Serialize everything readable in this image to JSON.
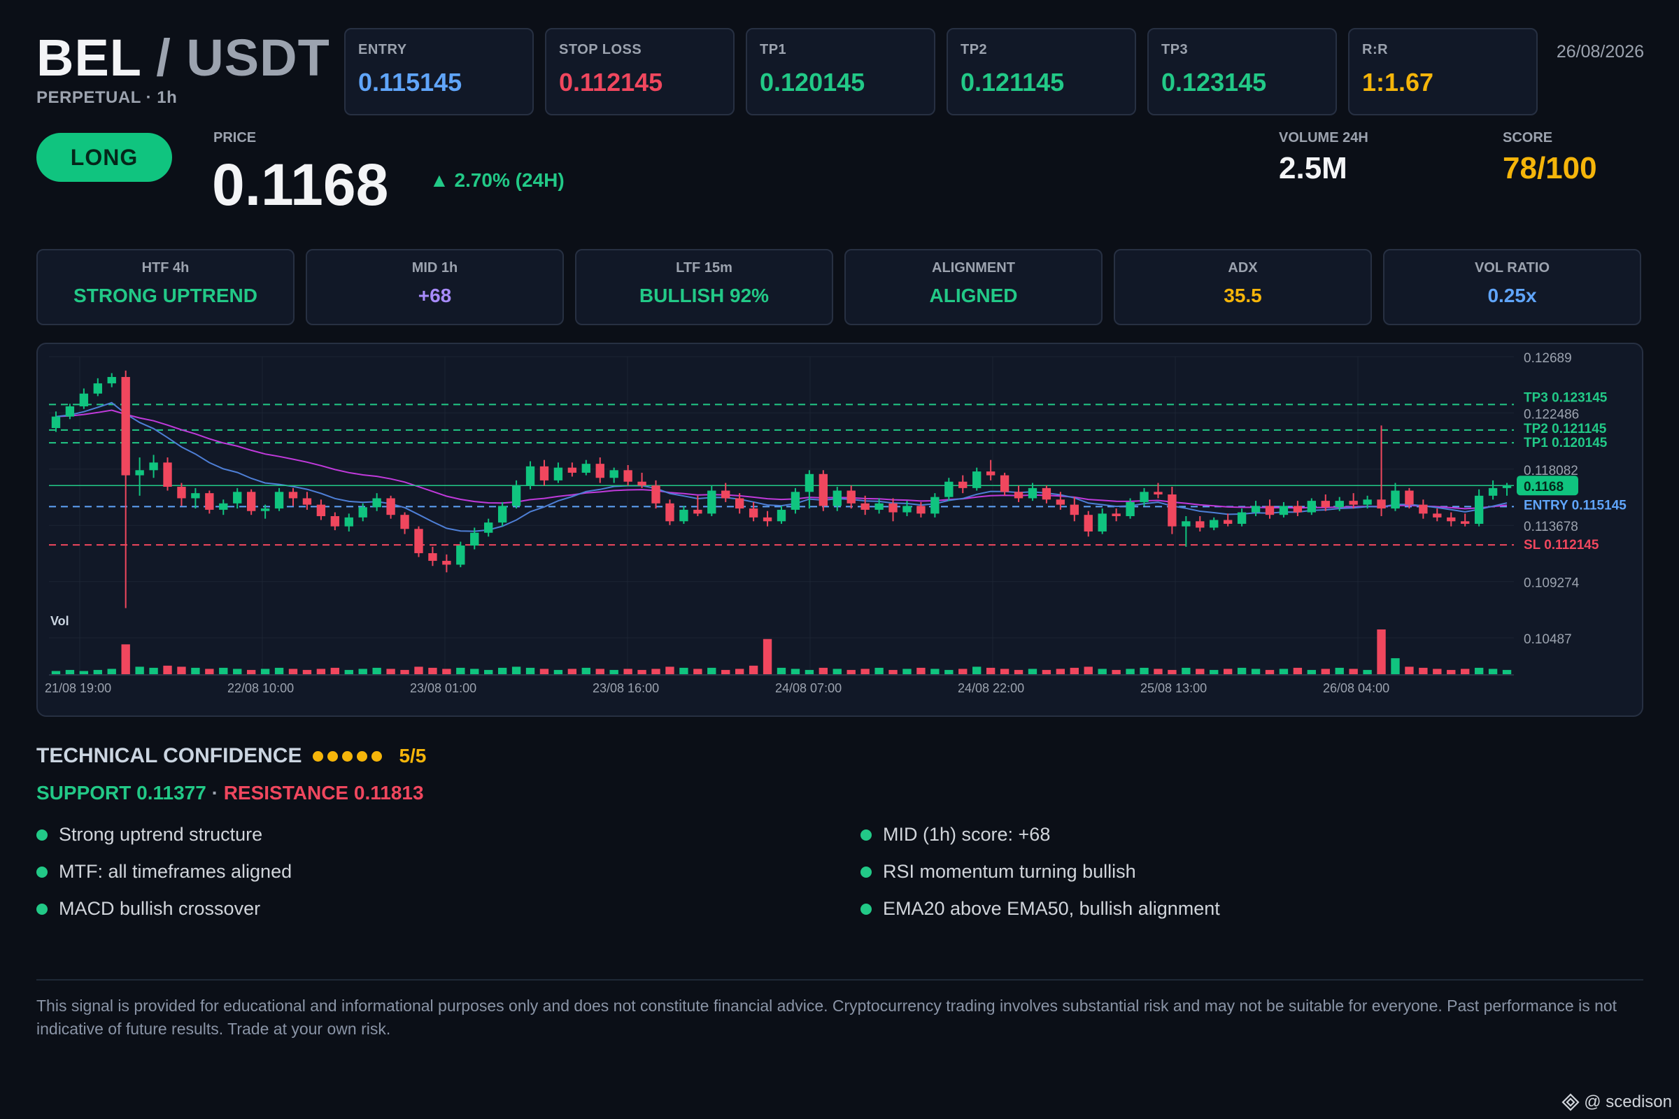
{
  "header": {
    "base": "BEL",
    "separator": " / ",
    "quote": "USDT",
    "subtitle": "PERPETUAL · 1h",
    "date": "26/08/2026"
  },
  "levels": [
    {
      "label": "ENTRY",
      "value": "0.115145",
      "color": "#60a5fa"
    },
    {
      "label": "STOP LOSS",
      "value": "0.112145",
      "color": "#f0475e"
    },
    {
      "label": "TP1",
      "value": "0.120145",
      "color": "#22c987"
    },
    {
      "label": "TP2",
      "value": "0.121145",
      "color": "#22c987"
    },
    {
      "label": "TP3",
      "value": "0.123145",
      "color": "#22c987"
    },
    {
      "label": "R:R",
      "value": "1:1.67",
      "color": "#f5b50a"
    }
  ],
  "signal": {
    "direction": "LONG"
  },
  "price": {
    "label": "PRICE",
    "value": "0.1168",
    "change": "▲ 2.70% (24H)"
  },
  "volume": {
    "label": "VOLUME 24H",
    "value": "2.5M"
  },
  "score": {
    "label": "SCORE",
    "value": "78/100"
  },
  "timeframes": [
    {
      "label": "HTF 4h",
      "value": "STRONG UPTREND",
      "color": "#22c987"
    },
    {
      "label": "MID 1h",
      "value": "+68",
      "color": "#a78bfa"
    },
    {
      "label": "LTF 15m",
      "value": "BULLISH 92%",
      "color": "#22c987"
    },
    {
      "label": "ALIGNMENT",
      "value": "ALIGNED",
      "color": "#22c987"
    },
    {
      "label": "ADX",
      "value": "35.5",
      "color": "#f5b50a"
    },
    {
      "label": "VOL RATIO",
      "value": "0.25x",
      "color": "#60a5fa"
    }
  ],
  "chart_data": {
    "type": "candlestick",
    "ylim": [
      0.10487,
      0.12689
    ],
    "y_ticks": [
      "0.12689",
      "0.122486",
      "0.118082",
      "0.113678",
      "0.109274",
      "0.10487"
    ],
    "x_ticks": [
      "21/08 19:00",
      "22/08 10:00",
      "23/08 01:00",
      "23/08 16:00",
      "24/08 07:00",
      "24/08 22:00",
      "25/08 13:00",
      "26/08 04:00"
    ],
    "volume_label": "Vol",
    "levels": [
      {
        "label": "TP3 0.123145",
        "value": 0.123145,
        "color": "#22c987"
      },
      {
        "label": "TP2 0.121145",
        "value": 0.121145,
        "color": "#22c987"
      },
      {
        "label": "TP1 0.120145",
        "value": 0.120145,
        "color": "#22c987"
      },
      {
        "label": "ENTRY 0.115145",
        "value": 0.115145,
        "color": "#60a5fa"
      },
      {
        "label": "SL 0.112145",
        "value": 0.112145,
        "color": "#f0475e"
      }
    ],
    "current_price": {
      "label": "0.1168",
      "value": 0.1168
    },
    "candles": [
      [
        0.1213,
        0.1226,
        0.121,
        0.1222
      ],
      [
        0.1222,
        0.1232,
        0.122,
        0.123
      ],
      [
        0.123,
        0.1244,
        0.1228,
        0.124
      ],
      [
        0.124,
        0.1252,
        0.1238,
        0.1248
      ],
      [
        0.1248,
        0.1256,
        0.1245,
        0.1253
      ],
      [
        0.1253,
        0.1258,
        0.1072,
        0.1176
      ],
      [
        0.1176,
        0.119,
        0.116,
        0.118
      ],
      [
        0.118,
        0.1192,
        0.1174,
        0.1186
      ],
      [
        0.1186,
        0.119,
        0.1164,
        0.1167
      ],
      [
        0.1167,
        0.117,
        0.1152,
        0.1158
      ],
      [
        0.1158,
        0.1166,
        0.115,
        0.1162
      ],
      [
        0.1162,
        0.1164,
        0.1146,
        0.1149
      ],
      [
        0.1149,
        0.1157,
        0.1145,
        0.1154
      ],
      [
        0.1154,
        0.1166,
        0.115,
        0.1163
      ],
      [
        0.1163,
        0.1165,
        0.1145,
        0.1148
      ],
      [
        0.1148,
        0.1153,
        0.1142,
        0.115
      ],
      [
        0.115,
        0.1166,
        0.1148,
        0.1163
      ],
      [
        0.1163,
        0.1166,
        0.1152,
        0.1158
      ],
      [
        0.1158,
        0.1163,
        0.1149,
        0.1153
      ],
      [
        0.1153,
        0.1157,
        0.1141,
        0.1144
      ],
      [
        0.1144,
        0.1147,
        0.1133,
        0.1136
      ],
      [
        0.1136,
        0.1146,
        0.1132,
        0.1143
      ],
      [
        0.1143,
        0.1154,
        0.114,
        0.1151
      ],
      [
        0.1151,
        0.1162,
        0.1148,
        0.1158
      ],
      [
        0.1158,
        0.116,
        0.1142,
        0.1145
      ],
      [
        0.1145,
        0.1147,
        0.113,
        0.1134
      ],
      [
        0.1134,
        0.1136,
        0.1112,
        0.1115
      ],
      [
        0.1115,
        0.112,
        0.1105,
        0.1109
      ],
      [
        0.1109,
        0.1114,
        0.11,
        0.1106
      ],
      [
        0.1106,
        0.1124,
        0.1104,
        0.1121
      ],
      [
        0.1121,
        0.1135,
        0.1118,
        0.1131
      ],
      [
        0.1131,
        0.1142,
        0.1128,
        0.1139
      ],
      [
        0.1139,
        0.1155,
        0.1136,
        0.1152
      ],
      [
        0.1152,
        0.1172,
        0.115,
        0.1168
      ],
      [
        0.1168,
        0.1187,
        0.1165,
        0.1183
      ],
      [
        0.1183,
        0.1188,
        0.1168,
        0.1172
      ],
      [
        0.1172,
        0.1186,
        0.117,
        0.1182
      ],
      [
        0.1182,
        0.1186,
        0.1175,
        0.1178
      ],
      [
        0.1178,
        0.1188,
        0.1176,
        0.1185
      ],
      [
        0.1185,
        0.119,
        0.117,
        0.1174
      ],
      [
        0.1174,
        0.1182,
        0.117,
        0.118
      ],
      [
        0.118,
        0.1184,
        0.1168,
        0.1171
      ],
      [
        0.1171,
        0.1178,
        0.1166,
        0.1168
      ],
      [
        0.1168,
        0.1172,
        0.115,
        0.1154
      ],
      [
        0.1154,
        0.1157,
        0.1137,
        0.114
      ],
      [
        0.114,
        0.1152,
        0.1138,
        0.1149
      ],
      [
        0.1149,
        0.116,
        0.1144,
        0.1146
      ],
      [
        0.1146,
        0.1168,
        0.1144,
        0.1164
      ],
      [
        0.1164,
        0.117,
        0.1155,
        0.1158
      ],
      [
        0.1158,
        0.1162,
        0.1146,
        0.115
      ],
      [
        0.115,
        0.1155,
        0.114,
        0.1143
      ],
      [
        0.1143,
        0.1148,
        0.1136,
        0.114
      ],
      [
        0.114,
        0.1152,
        0.1138,
        0.1149
      ],
      [
        0.1149,
        0.1166,
        0.1146,
        0.1163
      ],
      [
        0.1163,
        0.118,
        0.115,
        0.1177
      ],
      [
        0.1177,
        0.118,
        0.1148,
        0.1152
      ],
      [
        0.1152,
        0.1167,
        0.1148,
        0.1164
      ],
      [
        0.1164,
        0.1168,
        0.115,
        0.1154
      ],
      [
        0.1154,
        0.116,
        0.1145,
        0.1149
      ],
      [
        0.1149,
        0.1158,
        0.1146,
        0.1154
      ],
      [
        0.1154,
        0.1158,
        0.114,
        0.1147
      ],
      [
        0.1147,
        0.1156,
        0.1144,
        0.1152
      ],
      [
        0.1152,
        0.1155,
        0.1143,
        0.1146
      ],
      [
        0.1146,
        0.1162,
        0.1143,
        0.1159
      ],
      [
        0.1159,
        0.1174,
        0.1156,
        0.1171
      ],
      [
        0.1171,
        0.1176,
        0.1162,
        0.1166
      ],
      [
        0.1166,
        0.1182,
        0.1164,
        0.1179
      ],
      [
        0.1179,
        0.1188,
        0.1172,
        0.1176
      ],
      [
        0.1176,
        0.1178,
        0.116,
        0.1163
      ],
      [
        0.1163,
        0.1168,
        0.1155,
        0.1158
      ],
      [
        0.1158,
        0.117,
        0.1156,
        0.1166
      ],
      [
        0.1166,
        0.1168,
        0.1154,
        0.1157
      ],
      [
        0.1157,
        0.1163,
        0.1149,
        0.1153
      ],
      [
        0.1153,
        0.1159,
        0.114,
        0.1145
      ],
      [
        0.1145,
        0.1148,
        0.1128,
        0.1132
      ],
      [
        0.1132,
        0.115,
        0.113,
        0.1146
      ],
      [
        0.1146,
        0.115,
        0.114,
        0.1144
      ],
      [
        0.1144,
        0.1158,
        0.1142,
        0.1155
      ],
      [
        0.1155,
        0.1166,
        0.1152,
        0.1163
      ],
      [
        0.1163,
        0.117,
        0.1158,
        0.1161
      ],
      [
        0.1161,
        0.1167,
        0.113,
        0.1136
      ],
      [
        0.1136,
        0.1144,
        0.112,
        0.114
      ],
      [
        0.114,
        0.1144,
        0.1132,
        0.1135
      ],
      [
        0.1135,
        0.1143,
        0.1133,
        0.1141
      ],
      [
        0.1141,
        0.1146,
        0.1136,
        0.1138
      ],
      [
        0.1138,
        0.115,
        0.1136,
        0.1147
      ],
      [
        0.1147,
        0.1156,
        0.1144,
        0.1152
      ],
      [
        0.1152,
        0.1157,
        0.1142,
        0.1145
      ],
      [
        0.1145,
        0.1155,
        0.1143,
        0.1152
      ],
      [
        0.1152,
        0.1156,
        0.1144,
        0.1147
      ],
      [
        0.1147,
        0.1158,
        0.1145,
        0.1156
      ],
      [
        0.1156,
        0.1161,
        0.1148,
        0.1151
      ],
      [
        0.1151,
        0.1159,
        0.1148,
        0.1156
      ],
      [
        0.1156,
        0.1162,
        0.115,
        0.1153
      ],
      [
        0.1153,
        0.116,
        0.115,
        0.1157
      ],
      [
        0.1157,
        0.1215,
        0.1144,
        0.115
      ],
      [
        0.115,
        0.117,
        0.1148,
        0.1164
      ],
      [
        0.1164,
        0.1166,
        0.115,
        0.1153
      ],
      [
        0.1153,
        0.1157,
        0.1142,
        0.1146
      ],
      [
        0.1146,
        0.115,
        0.114,
        0.1143
      ],
      [
        0.1143,
        0.1147,
        0.1136,
        0.114
      ],
      [
        0.114,
        0.1146,
        0.1136,
        0.1138
      ],
      [
        0.1138,
        0.1165,
        0.1136,
        0.116
      ],
      [
        0.116,
        0.1172,
        0.1157,
        0.1166
      ],
      [
        0.1166,
        0.117,
        0.116,
        0.1168
      ]
    ],
    "volumes": [
      3,
      4,
      3,
      4,
      5,
      28,
      7,
      6,
      8,
      7,
      6,
      5,
      6,
      5,
      4,
      5,
      6,
      5,
      4,
      5,
      6,
      4,
      5,
      6,
      5,
      4,
      7,
      6,
      5,
      6,
      5,
      4,
      6,
      7,
      6,
      5,
      4,
      5,
      6,
      5,
      4,
      5,
      4,
      5,
      7,
      6,
      5,
      6,
      4,
      5,
      8,
      33,
      6,
      5,
      4,
      6,
      5,
      4,
      5,
      6,
      4,
      5,
      6,
      5,
      4,
      5,
      7,
      6,
      5,
      4,
      5,
      4,
      5,
      6,
      7,
      5,
      4,
      5,
      6,
      5,
      4,
      6,
      5,
      4,
      5,
      6,
      5,
      4,
      5,
      6,
      4,
      5,
      6,
      5,
      4,
      42,
      15,
      7,
      6,
      5,
      4,
      5,
      6,
      5,
      4
    ]
  },
  "confidence": {
    "title": "TECHNICAL CONFIDENCE",
    "score": "5/5"
  },
  "levels_summary": {
    "support": "SUPPORT 0.11377",
    "separator": " · ",
    "resistance": "RESISTANCE 0.11813"
  },
  "bullets": [
    "Strong uptrend structure",
    "MID (1h) score: +68",
    "MTF: all timeframes aligned",
    "RSI momentum turning bullish",
    "MACD bullish crossover",
    "EMA20 above EMA50, bullish alignment"
  ],
  "disclaimer": "This signal is provided for educational and informational purposes only and does not constitute financial advice. Cryptocurrency trading involves substantial risk and may not be suitable for everyone. Past performance is not indicative of future results. Trade at your own risk.",
  "watermark": "@ scedison"
}
